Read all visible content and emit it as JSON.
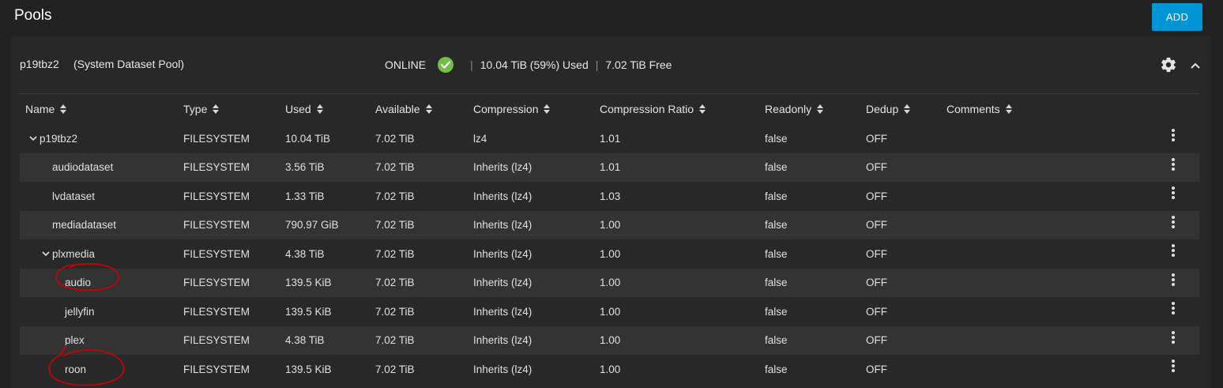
{
  "page": {
    "title": "Pools"
  },
  "toolbar": {
    "add_label": "ADD"
  },
  "pool": {
    "name": "p19tbz2",
    "subtitle": "(System Dataset Pool)",
    "status": "ONLINE",
    "used": "10.04 TiB (59%) Used",
    "free": "7.02 TiB Free",
    "separator": "|",
    "colors": {
      "online": "#71bf44",
      "accent": "#0095d5",
      "annotation": "#d40000"
    }
  },
  "table": {
    "headers": {
      "name": "Name",
      "type": "Type",
      "used": "Used",
      "available": "Available",
      "compression": "Compression",
      "ratio": "Compression Ratio",
      "readonly": "Readonly",
      "dedup": "Dedup",
      "comments": "Comments"
    },
    "rows": [
      {
        "name": "p19tbz2",
        "type": "FILESYSTEM",
        "used": "10.04 TiB",
        "available": "7.02 TiB",
        "compression": "lz4",
        "ratio": "1.01",
        "readonly": "false",
        "dedup": "OFF"
      },
      {
        "name": "audiodataset",
        "type": "FILESYSTEM",
        "used": "3.56 TiB",
        "available": "7.02 TiB",
        "compression": "Inherits (lz4)",
        "ratio": "1.01",
        "readonly": "false",
        "dedup": "OFF"
      },
      {
        "name": "lvdataset",
        "type": "FILESYSTEM",
        "used": "1.33 TiB",
        "available": "7.02 TiB",
        "compression": "Inherits (lz4)",
        "ratio": "1.03",
        "readonly": "false",
        "dedup": "OFF"
      },
      {
        "name": "mediadataset",
        "type": "FILESYSTEM",
        "used": "790.97 GiB",
        "available": "7.02 TiB",
        "compression": "Inherits (lz4)",
        "ratio": "1.00",
        "readonly": "false",
        "dedup": "OFF"
      },
      {
        "name": "plxmedia",
        "type": "FILESYSTEM",
        "used": "4.38 TiB",
        "available": "7.02 TiB",
        "compression": "Inherits (lz4)",
        "ratio": "1.00",
        "readonly": "false",
        "dedup": "OFF"
      },
      {
        "name": "audio",
        "type": "FILESYSTEM",
        "used": "139.5 KiB",
        "available": "7.02 TiB",
        "compression": "Inherits (lz4)",
        "ratio": "1.00",
        "readonly": "false",
        "dedup": "OFF"
      },
      {
        "name": "jellyfin",
        "type": "FILESYSTEM",
        "used": "139.5 KiB",
        "available": "7.02 TiB",
        "compression": "Inherits (lz4)",
        "ratio": "1.00",
        "readonly": "false",
        "dedup": "OFF"
      },
      {
        "name": "plex",
        "type": "FILESYSTEM",
        "used": "4.38 TiB",
        "available": "7.02 TiB",
        "compression": "Inherits (lz4)",
        "ratio": "1.00",
        "readonly": "false",
        "dedup": "OFF"
      },
      {
        "name": "roon",
        "type": "FILESYSTEM",
        "used": "139.5 KiB",
        "available": "7.02 TiB",
        "compression": "Inherits (lz4)",
        "ratio": "1.00",
        "readonly": "false",
        "dedup": "OFF"
      }
    ]
  },
  "icons": {
    "status": "check-circle-icon",
    "settings": "gear-icon",
    "collapse": "chevron-up-icon",
    "expand": "chevron-down-icon",
    "row_menu": "more-vertical-icon",
    "sort": "sort-icon"
  }
}
